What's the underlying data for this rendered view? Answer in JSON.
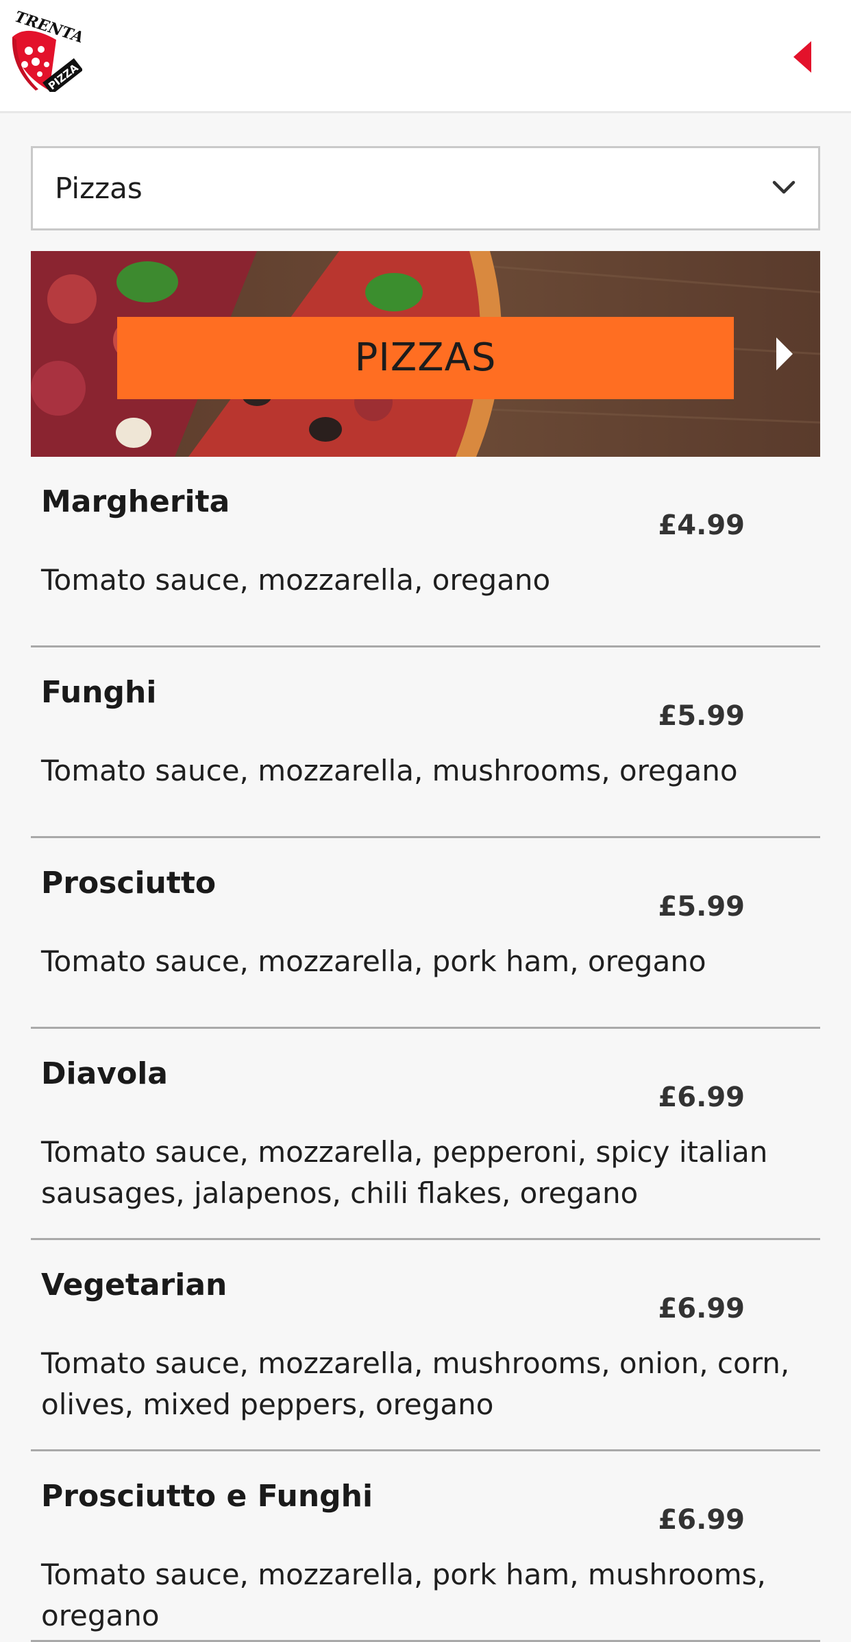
{
  "header": {
    "logo_text_top": "TRENTA",
    "logo_text_bottom": "PIZZA"
  },
  "category_select": {
    "value": "Pizzas"
  },
  "banner": {
    "title": "PIZZAS"
  },
  "menu": [
    {
      "name": "Margherita",
      "price": "£4.99",
      "description": "Tomato sauce, mozzarella, oregano"
    },
    {
      "name": "Funghi",
      "price": "£5.99",
      "description": "Tomato sauce, mozzarella, mushrooms, oregano"
    },
    {
      "name": "Prosciutto",
      "price": "£5.99",
      "description": "Tomato sauce, mozzarella, pork ham, oregano"
    },
    {
      "name": "Diavola",
      "price": "£6.99",
      "description": "Tomato sauce, mozzarella, pepperoni, spicy italian sausages, jalapenos, chili flakes, oregano"
    },
    {
      "name": "Vegetarian",
      "price": "£6.99",
      "description": "Tomato sauce, mozzarella, mushrooms, onion, corn, olives, mixed peppers, oregano"
    },
    {
      "name": "Prosciutto e Funghi",
      "price": "£6.99",
      "description": "Tomato sauce, mozzarella, pork ham, mushrooms, oregano"
    }
  ],
  "colors": {
    "brand_red": "#e3122b",
    "banner_orange": "#ff6e22",
    "background": "#f7f7f7"
  }
}
